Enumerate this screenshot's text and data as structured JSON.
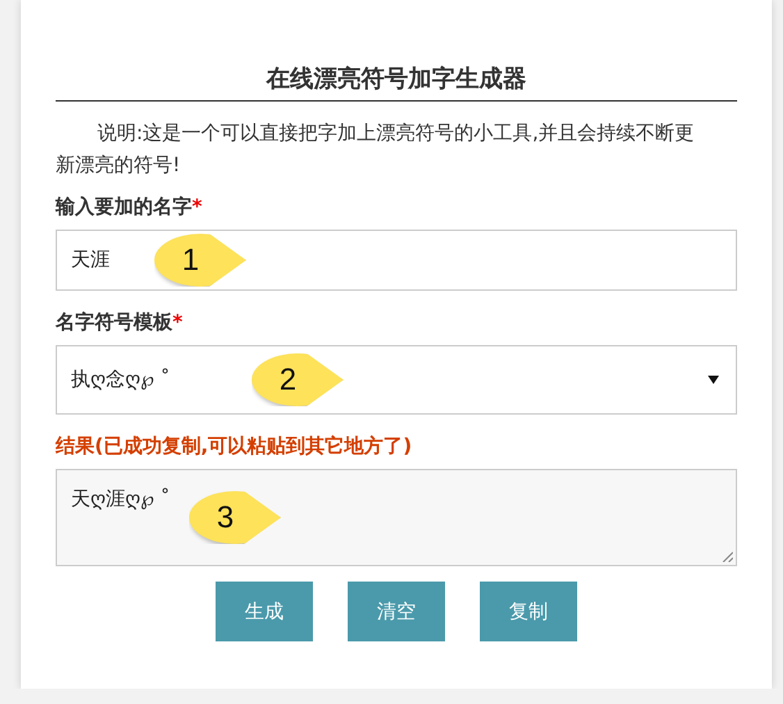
{
  "title": "在线漂亮符号加字生成器",
  "description": "说明:这是一个可以直接把字加上漂亮符号的小工具,并且会持续不断更新漂亮的符号!",
  "fields": [
    {
      "kind": "input",
      "label": "输入要加的名字",
      "required_mark": "*",
      "value": "天涯",
      "callout": "1"
    },
    {
      "kind": "select",
      "label": "名字符号模板",
      "required_mark": "*",
      "value": "执ღ念ღ℘ ˚",
      "callout": "2"
    },
    {
      "kind": "result",
      "label": "结果(已成功复制,可以粘贴到其它地方了)",
      "value": "天ღ涯ღ℘ ˚",
      "callout": "3"
    }
  ],
  "buttons": [
    "生成",
    "清空",
    "复制"
  ]
}
